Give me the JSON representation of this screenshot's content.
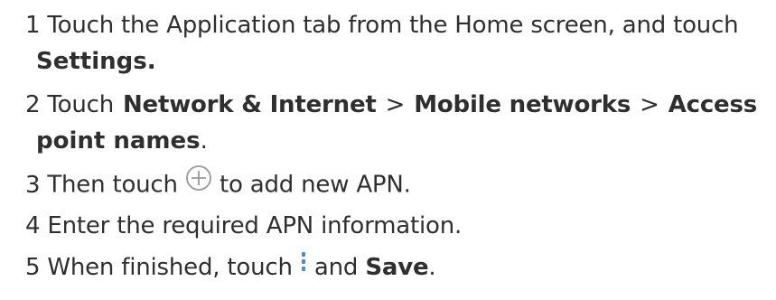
{
  "steps": [
    {
      "num": "1",
      "line1": "Touch the Application tab from the Home screen, and touch",
      "line2_bold": "Settings."
    },
    {
      "num": "2",
      "touch": "Touch",
      "item1": "Network & Internet",
      "sep1": ">",
      "item2": "Mobile networks",
      "sep2": ">",
      "item3a": "Access",
      "item3b": "point names",
      "end": "."
    },
    {
      "num": "3",
      "before": "Then touch",
      "icon": "add-circle-icon",
      "after": "to add new APN."
    },
    {
      "num": "4",
      "text": "Enter the required APN information."
    },
    {
      "num": "5",
      "before": "When finished, touch",
      "icon": "more-vertical-icon",
      "and": "and",
      "save": "Save",
      "end": "."
    }
  ],
  "colors": {
    "text": "#2f2f2f",
    "icon_circle": "#9a9a9a",
    "menu_dots": "#4a90c8"
  }
}
